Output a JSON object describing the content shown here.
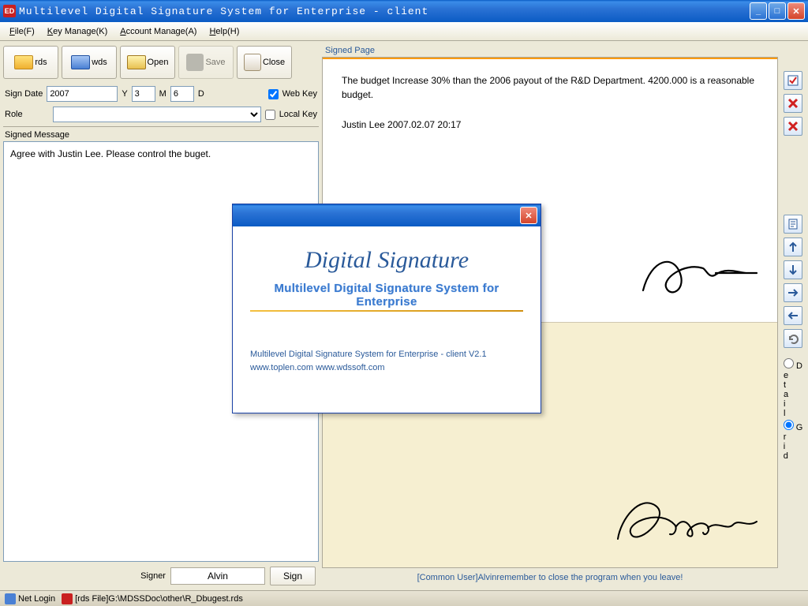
{
  "title": "Multilevel Digital Signature System for Enterprise - client",
  "menu": {
    "file": "File(F)",
    "keymanage": "Key Manage(K)",
    "account": "Account Manage(A)",
    "help": "Help(H)"
  },
  "toolbar": {
    "rds": "rds",
    "wds": "wds",
    "open": "Open",
    "save": "Save",
    "close": "Close"
  },
  "signdate": {
    "label": "Sign Date",
    "year": "2007",
    "y": "Y",
    "month": "3",
    "m": "M",
    "day": "6",
    "d": "D"
  },
  "webkey": "Web Key",
  "role_label": "Role",
  "role_value": "",
  "localkey": "Local Key",
  "signed_message_label": "Signed Message",
  "signed_message": "Agree with Justin Lee. Please control the buget.",
  "signer_label": "Signer",
  "signer_name": "Alvin",
  "sign_btn": "Sign",
  "signed_page_label": "Signed Page",
  "page1": {
    "body": "The budget Increase 30% than the 2006 payout of the R&D Department. 4200.000 is a reasonable budget.",
    "by": "Justin Lee   2007.02.07 20:17"
  },
  "status": "[Common User]Alvinremember to close the program when you leave!",
  "view": {
    "detail": "Detail",
    "grid": "Grid"
  },
  "about": {
    "title": "Digital Signature",
    "subtitle": "Multilevel Digital Signature System for Enterprise",
    "line1": "Multilevel Digital Signature System for Enterprise - client  V2.1",
    "line2": "www.toplen.com  www.wdssoft.com"
  },
  "taskbar": {
    "netlogin": "Net Login",
    "rds": "[rds File]G:\\MDSSDoc\\other\\R_Dbugest.rds"
  }
}
